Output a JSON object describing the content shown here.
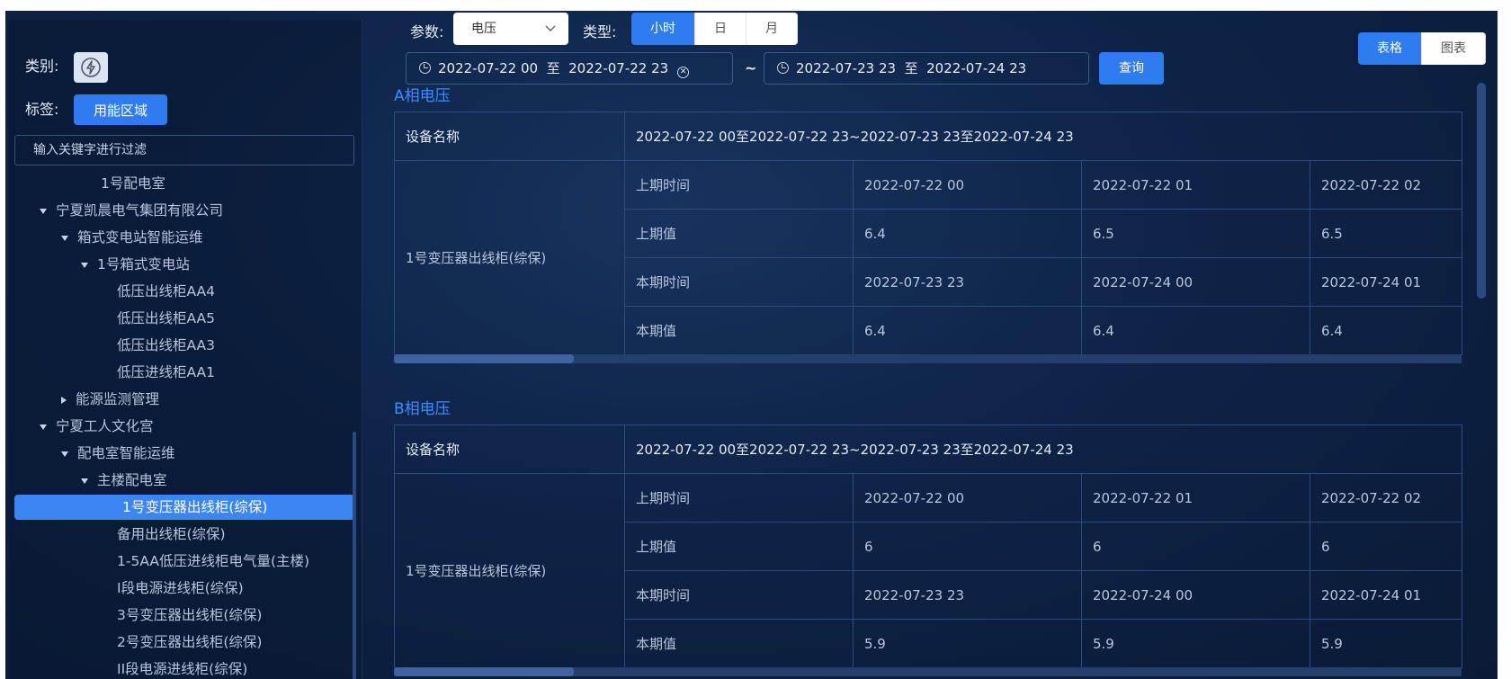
{
  "sidebar": {
    "category_label": "类别:",
    "tag_label": "标签:",
    "tag_value": "用能区域",
    "filter_placeholder": "输入关键字进行过滤",
    "tree": [
      {
        "label": "1号配电室",
        "level": 3,
        "arrow": "none"
      },
      {
        "label": "宁夏凯晨电气集团有限公司",
        "level": 0,
        "arrow": "down"
      },
      {
        "label": "箱式变电站智能运维",
        "level": 1,
        "arrow": "down"
      },
      {
        "label": "1号箱式变电站",
        "level": 2,
        "arrow": "down"
      },
      {
        "label": "低压出线柜AA4",
        "level": 3,
        "arrow": "none"
      },
      {
        "label": "低压出线柜AA5",
        "level": 3,
        "arrow": "none"
      },
      {
        "label": "低压出线柜AA3",
        "level": 3,
        "arrow": "none"
      },
      {
        "label": "低压进线柜AA1",
        "level": 3,
        "arrow": "none"
      },
      {
        "label": "能源监测管理",
        "level": 1,
        "arrow": "right"
      },
      {
        "label": "宁夏工人文化宫",
        "level": 0,
        "arrow": "down"
      },
      {
        "label": "配电室智能运维",
        "level": 1,
        "arrow": "down"
      },
      {
        "label": "主楼配电室",
        "level": 2,
        "arrow": "down"
      },
      {
        "label": "1号变压器出线柜(综保)",
        "level": 3,
        "arrow": "none",
        "selected": true
      },
      {
        "label": "备用出线柜(综保)",
        "level": 3,
        "arrow": "none"
      },
      {
        "label": "1-5AA低压进线柜电气量(主楼)",
        "level": 3,
        "arrow": "none"
      },
      {
        "label": "I段电源进线柜(综保)",
        "level": 3,
        "arrow": "none"
      },
      {
        "label": "3号变压器出线柜(综保)",
        "level": 3,
        "arrow": "none"
      },
      {
        "label": "2号变压器出线柜(综保)",
        "level": 3,
        "arrow": "none"
      },
      {
        "label": "II段电源进线柜(综保)",
        "level": 3,
        "arrow": "none"
      }
    ]
  },
  "toolbar": {
    "param_label": "参数:",
    "param_value": "电压",
    "type_label": "类型:",
    "type_options": [
      "小时",
      "日",
      "月"
    ],
    "type_selected": "小时",
    "range1_start": "2022-07-22 00",
    "range1_to": "至",
    "range1_end": "2022-07-22 23",
    "tilde": "~",
    "range2_start": "2022-07-23 23",
    "range2_to": "至",
    "range2_end": "2022-07-24 23",
    "query_label": "查询",
    "view_options": [
      "表格",
      "图表"
    ],
    "view_selected": "表格"
  },
  "sections": [
    {
      "title": "A相电压",
      "header_name": "设备名称",
      "header_range": "2022-07-22 00至2022-07-22 23~2022-07-23 23至2022-07-24 23",
      "device": "1号变压器出线柜(综保)",
      "rows": [
        {
          "label": "上期时间",
          "values": [
            "2022-07-22 00",
            "2022-07-22 01",
            "2022-07-22 02"
          ]
        },
        {
          "label": "上期值",
          "values": [
            "6.4",
            "6.5",
            "6.5"
          ]
        },
        {
          "label": "本期时间",
          "values": [
            "2022-07-23 23",
            "2022-07-24 00",
            "2022-07-24 01"
          ]
        },
        {
          "label": "本期值",
          "values": [
            "6.4",
            "6.4",
            "6.4"
          ]
        }
      ]
    },
    {
      "title": "B相电压",
      "header_name": "设备名称",
      "header_range": "2022-07-22 00至2022-07-22 23~2022-07-23 23至2022-07-24 23",
      "device": "1号变压器出线柜(综保)",
      "rows": [
        {
          "label": "上期时间",
          "values": [
            "2022-07-22 00",
            "2022-07-22 01",
            "2022-07-22 02"
          ]
        },
        {
          "label": "上期值",
          "values": [
            "6",
            "6",
            "6"
          ]
        },
        {
          "label": "本期时间",
          "values": [
            "2022-07-23 23",
            "2022-07-24 00",
            "2022-07-24 01"
          ]
        },
        {
          "label": "本期值",
          "values": [
            "5.9",
            "5.9",
            "5.9"
          ]
        }
      ]
    }
  ]
}
